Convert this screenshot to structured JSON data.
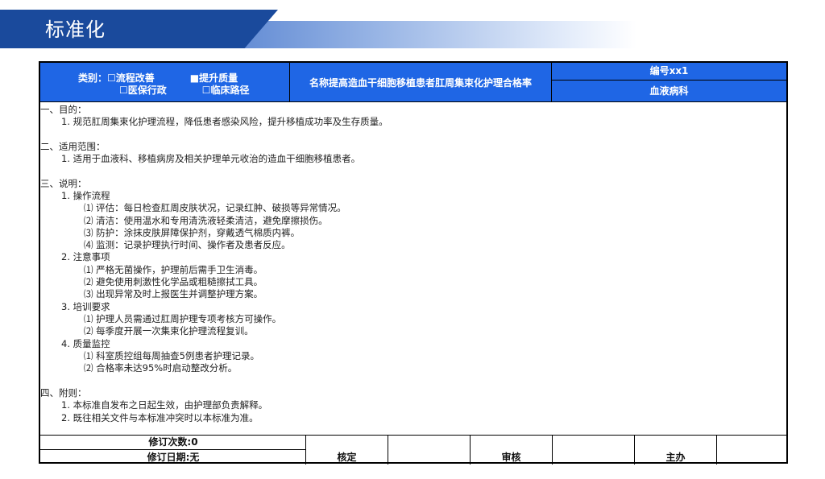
{
  "banner": {
    "title": "标准化"
  },
  "header": {
    "category_label": "类别：",
    "options": {
      "process_improvement": "☐流程改善",
      "quality_improvement": "■提升质量",
      "medical_insurance_admin": "☐医保行政",
      "clinical_pathway": "☐临床路径"
    },
    "name": "名称提高造血干细胞移植患者肛周集束化护理合格率",
    "number": "编号xx1",
    "department": "血液病科"
  },
  "content": {
    "s1_title": "一、目的：",
    "s1_1": "1. 规范肛周集束化护理流程，降低患者感染风险，提升移植成功率及生存质量。",
    "s2_title": "二、适用范围：",
    "s2_1": "1. 适用于血液科、移植病房及相关护理单元收治的造血干细胞移植患者。",
    "s3_title": "三、说明：",
    "s3_1": "1. 操作流程",
    "s3_1_1": "⑴ 评估：每日检查肛周皮肤状况，记录红肿、破损等异常情况。",
    "s3_1_2": "⑵ 清洁：使用温水和专用清洗液轻柔清洁，避免摩擦损伤。",
    "s3_1_3": "⑶ 防护：涂抹皮肤屏障保护剂，穿戴透气棉质内裤。",
    "s3_1_4": "⑷ 监测：记录护理执行时间、操作者及患者反应。",
    "s3_2": "2. 注意事项",
    "s3_2_1": "⑴ 严格无菌操作，护理前后需手卫生消毒。",
    "s3_2_2": "⑵ 避免使用刺激性化学品或粗糙擦拭工具。",
    "s3_2_3": "⑶ 出现异常及时上报医生并调整护理方案。",
    "s3_3": "3. 培训要求",
    "s3_3_1": "⑴ 护理人员需通过肛周护理专项考核方可操作。",
    "s3_3_2": "⑵ 每季度开展一次集束化护理流程复训。",
    "s3_4": "4. 质量监控",
    "s3_4_1": "⑴ 科室质控组每周抽查5例患者护理记录。",
    "s3_4_2": "⑵ 合格率未达95%时启动整改分析。",
    "s4_title": "四、附则：",
    "s4_1": "1. 本标准自发布之日起生效，由护理部负责解释。",
    "s4_2": "2. 既往相关文件与本标准冲突时以本标准为准。"
  },
  "footer": {
    "revision_count": "修订次数:0",
    "revision_date": "修订日期:无",
    "verify_label": "核定",
    "review_label": "审核",
    "owner_label": "主办"
  }
}
